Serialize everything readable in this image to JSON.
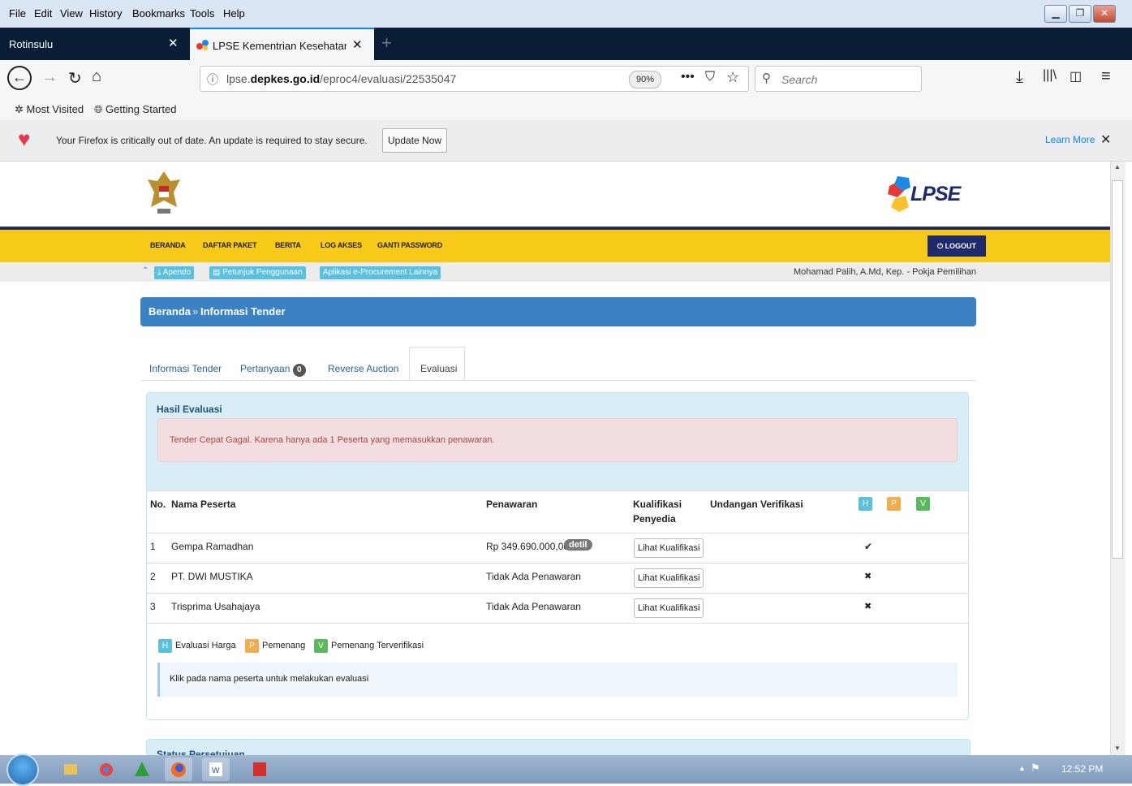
{
  "menubar": {
    "items": [
      "File",
      "Edit",
      "View",
      "History",
      "Bookmarks",
      "Tools",
      "Help"
    ]
  },
  "tabs": [
    {
      "title": "Rotinsulu",
      "active": false
    },
    {
      "title": "LPSE Kementrian Kesehatan R.I.",
      "active": true
    }
  ],
  "nav": {
    "url_prefix": "lpse.",
    "url_domain": "depkes.go.id",
    "url_path": "/eproc4/evaluasi/22535047",
    "zoom": "90%",
    "search_placeholder": "Search"
  },
  "bookmarks": [
    "Most Visited",
    "Getting Started"
  ],
  "notification": {
    "message": "Your Firefox is critically out of date. An update is required to stay secure.",
    "button": "Update Now",
    "learn_more": "Learn More"
  },
  "site": {
    "logo_text": "LPSE",
    "menu": [
      "BERANDA",
      "DAFTAR PAKET",
      "BERITA",
      "LOG AKSES",
      "GANTI PASSWORD"
    ],
    "logout": "LOGOUT",
    "sublinks": [
      "Apendo",
      "Petunjuk Penggunaan",
      "Aplikasi e-Procurement Lainnya"
    ],
    "user": "Mohamad Palih, A.Md, Kep. - Pokja Pemilihan"
  },
  "breadcrumb": {
    "home": "Beranda",
    "sep": "»",
    "current": "Informasi Tender"
  },
  "content_tabs": [
    {
      "label": "Informasi Tender"
    },
    {
      "label": "Pertanyaan",
      "badge": "0"
    },
    {
      "label": "Reverse Auction"
    },
    {
      "label": "Evaluasi",
      "active": true
    }
  ],
  "evaluasi": {
    "title": "Hasil Evaluasi",
    "alert": "Tender Cepat Gagal. Karena hanya ada 1 Peserta yang memasukkan penawaran.",
    "headers": {
      "no": "No.",
      "nama": "Nama Peserta",
      "penawaran": "Penawaran",
      "kualifikasi_1": "Kualifikasi",
      "kualifikasi_2": "Penyedia",
      "undangan": "Undangan Verifikasi",
      "h": "H",
      "p": "P",
      "v": "V"
    },
    "rows": [
      {
        "no": "1",
        "nama": "Gempa Ramadhan",
        "penawaran": "Rp 349.690.000,00",
        "detil": "detil",
        "button": "Lihat Kualifikasi",
        "mark": "✔"
      },
      {
        "no": "2",
        "nama": "PT. DWI MUSTIKA",
        "penawaran": "Tidak Ada Penawaran",
        "button": "Lihat Kualifikasi",
        "mark": "✖"
      },
      {
        "no": "3",
        "nama": "Trisprima Usahajaya",
        "penawaran": "Tidak Ada Penawaran",
        "button": "Lihat Kualifikasi",
        "mark": "✖"
      }
    ],
    "legend": [
      {
        "key": "H",
        "label": "Evaluasi Harga",
        "color": "#5bc0de"
      },
      {
        "key": "P",
        "label": "Pemenang",
        "color": "#f0ad4e"
      },
      {
        "key": "V",
        "label": "Pemenang Terverifikasi",
        "color": "#5cb85c"
      }
    ],
    "info": "Klik pada nama peserta untuk melakukan evaluasi"
  },
  "next_panel_title": "Status Persetujuan",
  "taskbar": {
    "time": "12:52 PM"
  },
  "colors": {
    "accent_blue": "#3b82c4",
    "menu_yellow": "#f7c919",
    "alert_red": "#a94442"
  }
}
